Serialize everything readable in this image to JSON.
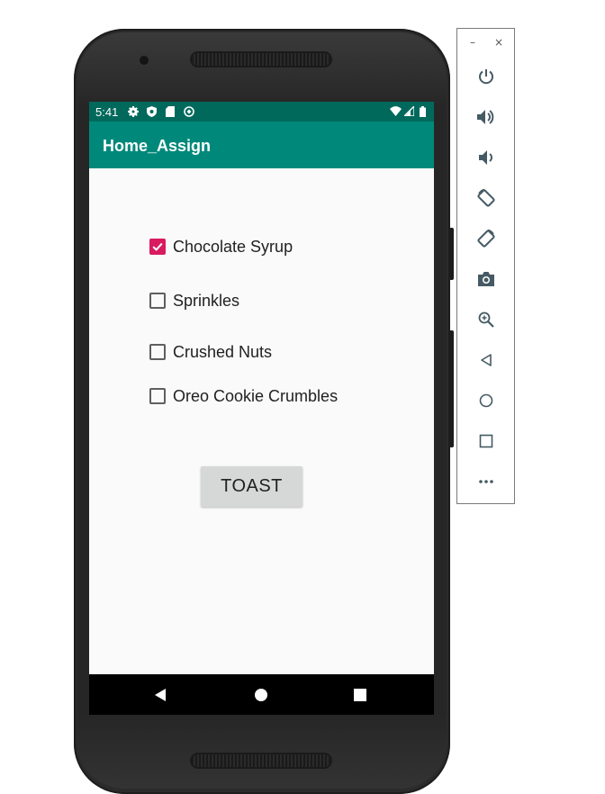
{
  "status_bar": {
    "time": "5:41",
    "icons_left": [
      "settings-icon",
      "shield-icon",
      "sd-card-icon",
      "sync-icon"
    ],
    "icons_right": [
      "wifi-icon",
      "signal-icon",
      "battery-icon"
    ]
  },
  "app_bar": {
    "title": "Home_Assign"
  },
  "checkboxes": [
    {
      "label": "Chocolate Syrup",
      "checked": true
    },
    {
      "label": "Sprinkles",
      "checked": false
    },
    {
      "label": "Crushed Nuts",
      "checked": false
    },
    {
      "label": "Oreo Cookie Crumbles",
      "checked": false
    }
  ],
  "toast_button": {
    "label": "TOAST"
  },
  "nav_bar": [
    "back-icon",
    "home-icon",
    "recents-icon"
  ],
  "emulator_toolbar": {
    "minimize": "–",
    "close": "×",
    "buttons": [
      "power-icon",
      "volume-up-icon",
      "volume-down-icon",
      "rotate-left-icon",
      "rotate-right-icon",
      "camera-icon",
      "zoom-icon",
      "back-icon",
      "home-icon",
      "overview-icon",
      "more-icon"
    ]
  },
  "colors": {
    "status_bar": "#00695c",
    "app_bar": "#00897b",
    "accent": "#d81b60",
    "screen_bg": "#fafafa",
    "toolbar_icon": "#455a64"
  }
}
